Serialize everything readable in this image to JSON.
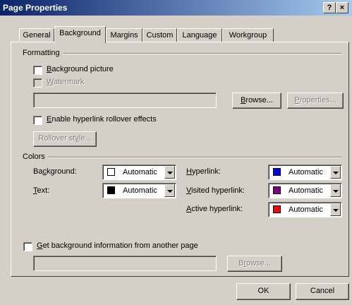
{
  "window": {
    "title": "Page Properties",
    "help_glyph": "?",
    "close_glyph": "×"
  },
  "tabs": [
    {
      "label": "General"
    },
    {
      "label": "Background"
    },
    {
      "label": "Margins"
    },
    {
      "label": "Custom"
    },
    {
      "label": "Language"
    },
    {
      "label": "Workgroup"
    }
  ],
  "active_tab": "Background",
  "formatting": {
    "heading": "Formatting",
    "background_picture": {
      "label_underlined": "B",
      "label_rest": "ackground picture",
      "checked": false
    },
    "watermark": {
      "label_underlined": "W",
      "label_rest": "atermark",
      "checked": false,
      "enabled": false
    },
    "path_value": "",
    "browse_label_underlined": "B",
    "browse_label_rest": "rowse...",
    "properties_label_underlined": "P",
    "properties_label_rest": "roperties...",
    "rollover": {
      "label_underlined": "E",
      "label_rest": "nable hyperlink rollover effects",
      "checked": false
    },
    "rollover_style_pre": "Rollover st",
    "rollover_style_underlined": "y",
    "rollover_style_post": "le..."
  },
  "colors": {
    "heading": "Colors",
    "background": {
      "pre": "Ba",
      "u": "c",
      "post": "kground:",
      "value": "Automatic",
      "color": "#ffffff"
    },
    "text": {
      "pre": "",
      "u": "T",
      "post": "ext:",
      "value": "Automatic",
      "color": "#000000"
    },
    "hyperlink": {
      "pre": "",
      "u": "H",
      "post": "yperlink:",
      "value": "Automatic",
      "color": "#0000ff"
    },
    "visited": {
      "pre": "",
      "u": "V",
      "post": "isited hyperlink:",
      "value": "Automatic",
      "color": "#800080"
    },
    "active": {
      "pre": "",
      "u": "A",
      "post": "ctive hyperlink:",
      "value": "Automatic",
      "color": "#ff0000"
    }
  },
  "other_page": {
    "label_underlined": "G",
    "label_rest": "et background information from another page",
    "checked": false,
    "path_value": "",
    "browse_pre": "B",
    "browse_u": "r",
    "browse_post": "owse..."
  },
  "footer": {
    "ok_label": "OK",
    "cancel_label": "Cancel"
  }
}
